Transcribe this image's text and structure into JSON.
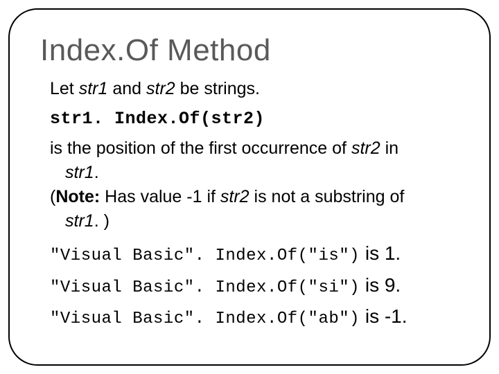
{
  "title": "Index.Of Method",
  "intro": {
    "p1a": "Let ",
    "p1b": "str1",
    "p1c": " and ",
    "p1d": "str2",
    "p1e": " be strings."
  },
  "code_line": "str1. Index.Of(str2)",
  "explain": {
    "l1a": "is the position of the first occurrence of ",
    "l1b": "str2",
    "l1c": " in",
    "l2a": "str1",
    "l2b": ".",
    "l3a": "(",
    "l3b": "Note:",
    "l3c": " Has value -1 if ",
    "l3d": "str2",
    "l3e": " is not a substring of",
    "l4a": "str1",
    "l4b": ". )"
  },
  "examples": [
    {
      "code": "\"Visual Basic\". Index.Of(\"is\")",
      "is": " is ",
      "result": "1."
    },
    {
      "code": "\"Visual Basic\". Index.Of(\"si\")",
      "is": " is ",
      "result": "9."
    },
    {
      "code": "\"Visual Basic\". Index.Of(\"ab\")",
      "is": " is ",
      "result": "-1."
    }
  ]
}
